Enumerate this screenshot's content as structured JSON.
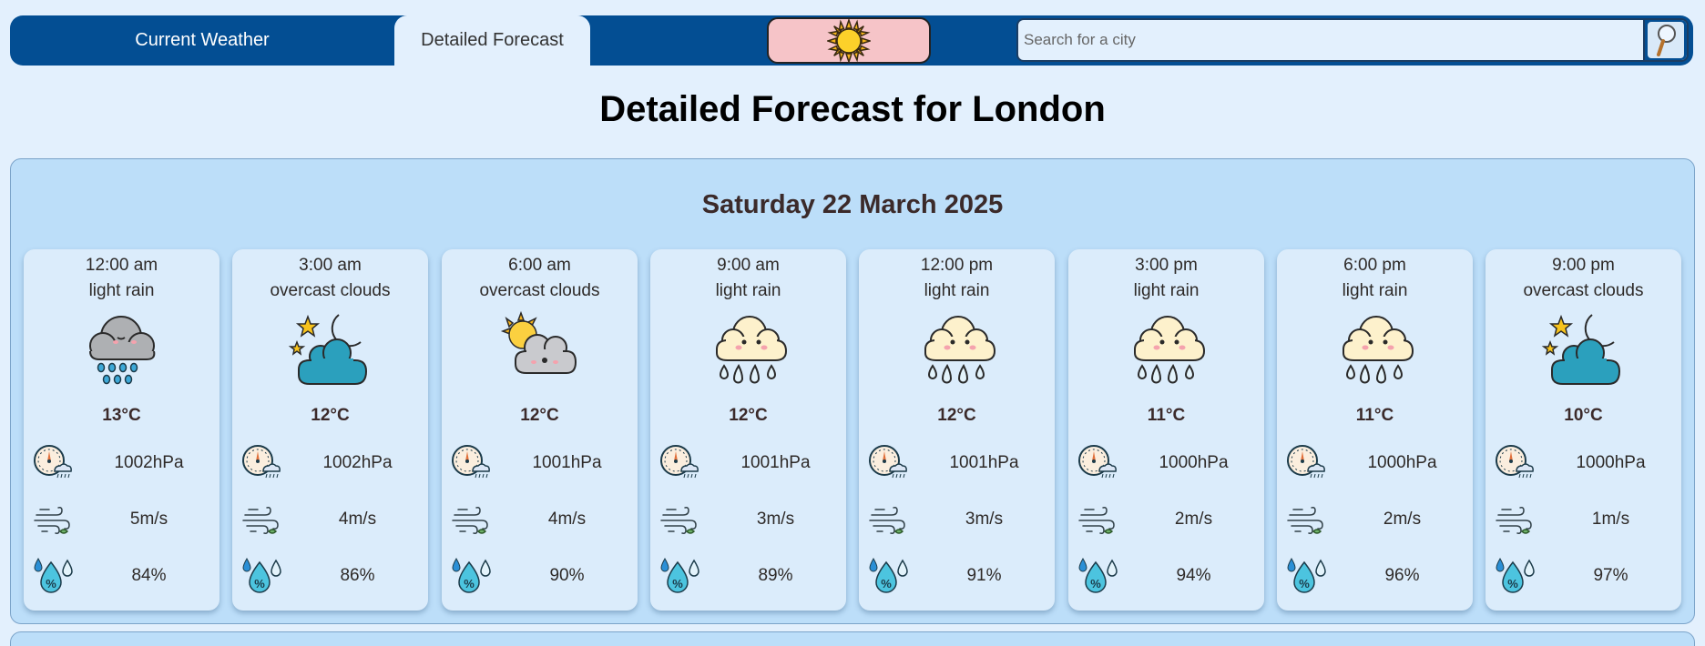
{
  "nav": {
    "tabs": [
      {
        "label": "Current Weather",
        "active": false
      },
      {
        "label": "Detailed Forecast",
        "active": true
      }
    ],
    "theme_icon": "sun-icon",
    "search": {
      "placeholder": "Search for a city",
      "value": "",
      "button_icon": "magnifier-icon"
    }
  },
  "page_title": "Detailed Forecast for London",
  "day": {
    "title": "Saturday 22 March 2025",
    "entries": [
      {
        "time": "12:00 am",
        "desc": "light rain",
        "icon": "grey-rain-cloud-icon",
        "temp": "13°C",
        "pressure": "1002hPa",
        "wind": "5m/s",
        "humidity": "84%"
      },
      {
        "time": "3:00 am",
        "desc": "overcast clouds",
        "icon": "night-cloud-icon",
        "temp": "12°C",
        "pressure": "1002hPa",
        "wind": "4m/s",
        "humidity": "86%"
      },
      {
        "time": "6:00 am",
        "desc": "overcast clouds",
        "icon": "sun-cloud-icon",
        "temp": "12°C",
        "pressure": "1001hPa",
        "wind": "4m/s",
        "humidity": "90%"
      },
      {
        "time": "9:00 am",
        "desc": "light rain",
        "icon": "rain-cloud-icon",
        "temp": "12°C",
        "pressure": "1001hPa",
        "wind": "3m/s",
        "humidity": "89%"
      },
      {
        "time": "12:00 pm",
        "desc": "light rain",
        "icon": "rain-cloud-icon",
        "temp": "12°C",
        "pressure": "1001hPa",
        "wind": "3m/s",
        "humidity": "91%"
      },
      {
        "time": "3:00 pm",
        "desc": "light rain",
        "icon": "rain-cloud-icon",
        "temp": "11°C",
        "pressure": "1000hPa",
        "wind": "2m/s",
        "humidity": "94%"
      },
      {
        "time": "6:00 pm",
        "desc": "light rain",
        "icon": "rain-cloud-icon",
        "temp": "11°C",
        "pressure": "1000hPa",
        "wind": "2m/s",
        "humidity": "96%"
      },
      {
        "time": "9:00 pm",
        "desc": "overcast clouds",
        "icon": "night-cloud-icon",
        "temp": "10°C",
        "pressure": "1000hPa",
        "wind": "1m/s",
        "humidity": "97%"
      }
    ]
  }
}
